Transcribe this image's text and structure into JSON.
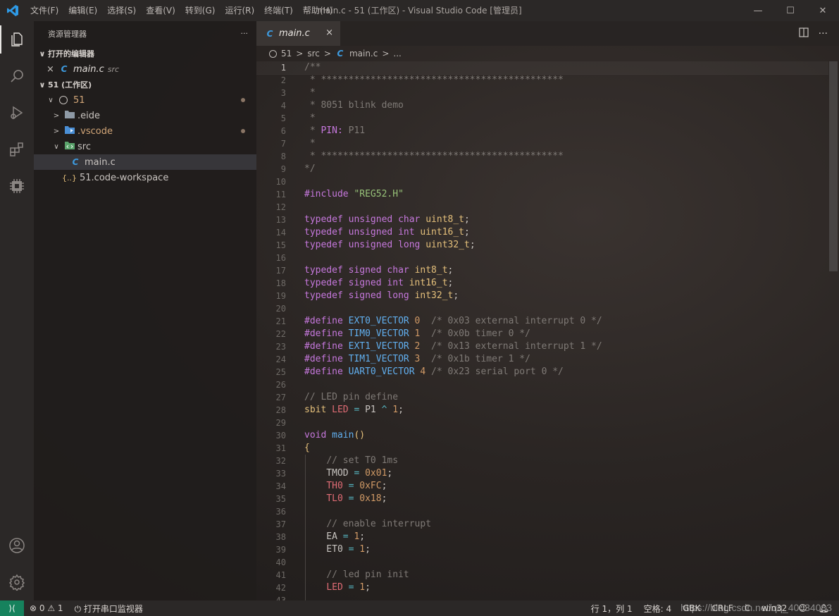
{
  "window": {
    "title": "main.c - 51 (工作区) - Visual Studio Code [管理员]",
    "menu": [
      "文件(F)",
      "编辑(E)",
      "选择(S)",
      "查看(V)",
      "转到(G)",
      "运行(R)",
      "终端(T)",
      "帮助(H)"
    ]
  },
  "activity_bar": {
    "items": [
      "explorer-icon",
      "search-icon",
      "run-debug-icon",
      "extensions-icon",
      "chip-icon"
    ],
    "bottom": [
      "account-icon",
      "gear-icon"
    ]
  },
  "sidebar": {
    "title": "资源管理器",
    "more": "···",
    "open_editors_label": "打开的编辑器",
    "open_editors": [
      {
        "close": "×",
        "icon": "C",
        "name": "main.c",
        "dir": "src"
      }
    ],
    "workspace_label": "51 (工作区)",
    "tree": [
      {
        "chevron": "∨",
        "name": "51",
        "modified": true
      },
      {
        "chevron": ">",
        "name": ".eide"
      },
      {
        "chevron": ">",
        "name": ".vscode",
        "modified": true
      },
      {
        "chevron": "∨",
        "name": "src"
      },
      {
        "icon": "C",
        "name": "main.c",
        "selected": true
      },
      {
        "icon": "{..}",
        "name": "51.code-workspace"
      }
    ]
  },
  "editor": {
    "tab": {
      "icon": "C",
      "label": "main.c",
      "close": "×"
    },
    "breadcrumb": {
      "root": "51",
      "sep": ">",
      "folder": "src",
      "icon": "C",
      "file": "main.c",
      "trail": "..."
    },
    "code_lines": [
      {
        "n": "1",
        "t": [
          [
            "tok-comment",
            "/**"
          ]
        ]
      },
      {
        "n": "2",
        "t": [
          [
            "tok-comment",
            " * ********************************************"
          ]
        ]
      },
      {
        "n": "3",
        "t": [
          [
            "tok-comment",
            " *"
          ]
        ]
      },
      {
        "n": "4",
        "t": [
          [
            "tok-comment",
            " * 8051 blink demo"
          ]
        ]
      },
      {
        "n": "5",
        "t": [
          [
            "tok-comment",
            " *"
          ]
        ]
      },
      {
        "n": "6",
        "t": [
          [
            "tok-comment",
            " * "
          ],
          [
            "tok-kw",
            "PIN:"
          ],
          [
            "tok-comment",
            " P11"
          ]
        ]
      },
      {
        "n": "7",
        "t": [
          [
            "tok-comment",
            " *"
          ]
        ]
      },
      {
        "n": "8",
        "t": [
          [
            "tok-comment",
            " * ********************************************"
          ]
        ]
      },
      {
        "n": "9",
        "t": [
          [
            "tok-comment",
            "*/"
          ]
        ]
      },
      {
        "n": "10",
        "t": []
      },
      {
        "n": "11",
        "t": [
          [
            "tok-kw",
            "#include"
          ],
          [
            "tok-plain",
            " "
          ],
          [
            "tok-str",
            "\"REG52.H\""
          ]
        ]
      },
      {
        "n": "12",
        "t": []
      },
      {
        "n": "13",
        "t": [
          [
            "tok-kw",
            "typedef"
          ],
          [
            "tok-plain",
            " "
          ],
          [
            "tok-kw",
            "unsigned"
          ],
          [
            "tok-plain",
            " "
          ],
          [
            "tok-kw",
            "char"
          ],
          [
            "tok-plain",
            " "
          ],
          [
            "tok-id",
            "uint8_t"
          ],
          [
            "tok-plain",
            ";"
          ]
        ]
      },
      {
        "n": "14",
        "t": [
          [
            "tok-kw",
            "typedef"
          ],
          [
            "tok-plain",
            " "
          ],
          [
            "tok-kw",
            "unsigned"
          ],
          [
            "tok-plain",
            " "
          ],
          [
            "tok-kw",
            "int"
          ],
          [
            "tok-plain",
            " "
          ],
          [
            "tok-id",
            "uint16_t"
          ],
          [
            "tok-plain",
            ";"
          ]
        ]
      },
      {
        "n": "15",
        "t": [
          [
            "tok-kw",
            "typedef"
          ],
          [
            "tok-plain",
            " "
          ],
          [
            "tok-kw",
            "unsigned"
          ],
          [
            "tok-plain",
            " "
          ],
          [
            "tok-kw",
            "long"
          ],
          [
            "tok-plain",
            " "
          ],
          [
            "tok-id",
            "uint32_t"
          ],
          [
            "tok-plain",
            ";"
          ]
        ]
      },
      {
        "n": "16",
        "t": []
      },
      {
        "n": "17",
        "t": [
          [
            "tok-kw",
            "typedef"
          ],
          [
            "tok-plain",
            " "
          ],
          [
            "tok-kw",
            "signed"
          ],
          [
            "tok-plain",
            " "
          ],
          [
            "tok-kw",
            "char"
          ],
          [
            "tok-plain",
            " "
          ],
          [
            "tok-id",
            "int8_t"
          ],
          [
            "tok-plain",
            ";"
          ]
        ]
      },
      {
        "n": "18",
        "t": [
          [
            "tok-kw",
            "typedef"
          ],
          [
            "tok-plain",
            " "
          ],
          [
            "tok-kw",
            "signed"
          ],
          [
            "tok-plain",
            " "
          ],
          [
            "tok-kw",
            "int"
          ],
          [
            "tok-plain",
            " "
          ],
          [
            "tok-id",
            "int16_t"
          ],
          [
            "tok-plain",
            ";"
          ]
        ]
      },
      {
        "n": "19",
        "t": [
          [
            "tok-kw",
            "typedef"
          ],
          [
            "tok-plain",
            " "
          ],
          [
            "tok-kw",
            "signed"
          ],
          [
            "tok-plain",
            " "
          ],
          [
            "tok-kw",
            "long"
          ],
          [
            "tok-plain",
            " "
          ],
          [
            "tok-id",
            "int32_t"
          ],
          [
            "tok-plain",
            ";"
          ]
        ]
      },
      {
        "n": "20",
        "t": []
      },
      {
        "n": "21",
        "t": [
          [
            "tok-kw",
            "#define"
          ],
          [
            "tok-plain",
            " "
          ],
          [
            "tok-macro",
            "EXT0_VECTOR"
          ],
          [
            "tok-plain",
            " "
          ],
          [
            "tok-num",
            "0"
          ],
          [
            "tok-comment",
            "  /* 0x03 external interrupt 0 */"
          ]
        ]
      },
      {
        "n": "22",
        "t": [
          [
            "tok-kw",
            "#define"
          ],
          [
            "tok-plain",
            " "
          ],
          [
            "tok-macro",
            "TIM0_VECTOR"
          ],
          [
            "tok-plain",
            " "
          ],
          [
            "tok-num",
            "1"
          ],
          [
            "tok-comment",
            "  /* 0x0b timer 0 */"
          ]
        ]
      },
      {
        "n": "23",
        "t": [
          [
            "tok-kw",
            "#define"
          ],
          [
            "tok-plain",
            " "
          ],
          [
            "tok-macro",
            "EXT1_VECTOR"
          ],
          [
            "tok-plain",
            " "
          ],
          [
            "tok-num",
            "2"
          ],
          [
            "tok-comment",
            "  /* 0x13 external interrupt 1 */"
          ]
        ]
      },
      {
        "n": "24",
        "t": [
          [
            "tok-kw",
            "#define"
          ],
          [
            "tok-plain",
            " "
          ],
          [
            "tok-macro",
            "TIM1_VECTOR"
          ],
          [
            "tok-plain",
            " "
          ],
          [
            "tok-num",
            "3"
          ],
          [
            "tok-comment",
            "  /* 0x1b timer 1 */"
          ]
        ]
      },
      {
        "n": "25",
        "t": [
          [
            "tok-kw",
            "#define"
          ],
          [
            "tok-plain",
            " "
          ],
          [
            "tok-macro",
            "UART0_VECTOR"
          ],
          [
            "tok-plain",
            " "
          ],
          [
            "tok-num",
            "4"
          ],
          [
            "tok-comment",
            " /* 0x23 serial port 0 */"
          ]
        ]
      },
      {
        "n": "26",
        "t": []
      },
      {
        "n": "27",
        "t": [
          [
            "tok-comment",
            "// LED pin define"
          ]
        ]
      },
      {
        "n": "28",
        "t": [
          [
            "tok-id",
            "sbit"
          ],
          [
            "tok-plain",
            " "
          ],
          [
            "tok-var",
            "LED"
          ],
          [
            "tok-plain",
            " "
          ],
          [
            "tok-op",
            "="
          ],
          [
            "tok-plain",
            " P1 "
          ],
          [
            "tok-op",
            "^"
          ],
          [
            "tok-plain",
            " "
          ],
          [
            "tok-num",
            "1"
          ],
          [
            "tok-plain",
            ";"
          ]
        ]
      },
      {
        "n": "29",
        "t": []
      },
      {
        "n": "30",
        "t": [
          [
            "tok-kw",
            "void"
          ],
          [
            "tok-plain",
            " "
          ],
          [
            "tok-fn",
            "main"
          ],
          [
            "tok-brace",
            "()"
          ]
        ]
      },
      {
        "n": "31",
        "t": [
          [
            "tok-brace",
            "{"
          ]
        ]
      },
      {
        "n": "32",
        "t": [
          [
            "tok-plain",
            "    "
          ],
          [
            "tok-comment",
            "// set T0 1ms"
          ]
        ]
      },
      {
        "n": "33",
        "t": [
          [
            "tok-plain",
            "    TMOD "
          ],
          [
            "tok-op",
            "="
          ],
          [
            "tok-plain",
            " "
          ],
          [
            "tok-num",
            "0x01"
          ],
          [
            "tok-plain",
            ";"
          ]
        ]
      },
      {
        "n": "34",
        "t": [
          [
            "tok-plain",
            "    "
          ],
          [
            "tok-var",
            "TH0"
          ],
          [
            "tok-plain",
            " "
          ],
          [
            "tok-op",
            "="
          ],
          [
            "tok-plain",
            " "
          ],
          [
            "tok-num",
            "0xFC"
          ],
          [
            "tok-plain",
            ";"
          ]
        ]
      },
      {
        "n": "35",
        "t": [
          [
            "tok-plain",
            "    "
          ],
          [
            "tok-var",
            "TL0"
          ],
          [
            "tok-plain",
            " "
          ],
          [
            "tok-op",
            "="
          ],
          [
            "tok-plain",
            " "
          ],
          [
            "tok-num",
            "0x18"
          ],
          [
            "tok-plain",
            ";"
          ]
        ]
      },
      {
        "n": "36",
        "t": []
      },
      {
        "n": "37",
        "t": [
          [
            "tok-plain",
            "    "
          ],
          [
            "tok-comment",
            "// enable interrupt"
          ]
        ]
      },
      {
        "n": "38",
        "t": [
          [
            "tok-plain",
            "    EA "
          ],
          [
            "tok-op",
            "="
          ],
          [
            "tok-plain",
            " "
          ],
          [
            "tok-num",
            "1"
          ],
          [
            "tok-plain",
            ";"
          ]
        ]
      },
      {
        "n": "39",
        "t": [
          [
            "tok-plain",
            "    ET0 "
          ],
          [
            "tok-op",
            "="
          ],
          [
            "tok-plain",
            " "
          ],
          [
            "tok-num",
            "1"
          ],
          [
            "tok-plain",
            ";"
          ]
        ]
      },
      {
        "n": "40",
        "t": []
      },
      {
        "n": "41",
        "t": [
          [
            "tok-plain",
            "    "
          ],
          [
            "tok-comment",
            "// led pin init"
          ]
        ]
      },
      {
        "n": "42",
        "t": [
          [
            "tok-plain",
            "    "
          ],
          [
            "tok-var",
            "LED"
          ],
          [
            "tok-plain",
            " "
          ],
          [
            "tok-op",
            "="
          ],
          [
            "tok-plain",
            " "
          ],
          [
            "tok-num",
            "1"
          ],
          [
            "tok-plain",
            ";"
          ]
        ]
      },
      {
        "n": "43",
        "t": []
      }
    ]
  },
  "statusbar": {
    "remote": "⟩⟨",
    "errors": "⊗ 0",
    "warnings": "⚠ 1",
    "serial": "打开串口监视器",
    "position": "行 1，列 1",
    "spaces": "空格: 4",
    "encoding": "GBK",
    "eol": "CRLF",
    "language": "C",
    "platform": "win32"
  },
  "watermark": "https://blog.csdn.net/qq_40034083",
  "colors": {
    "accent": "#16825d",
    "c_icon": "#3d9be0"
  }
}
